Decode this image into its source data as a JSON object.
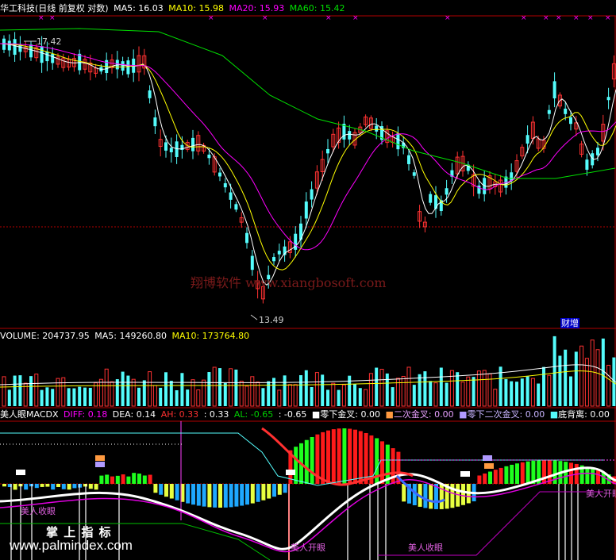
{
  "price_panel": {
    "stock_name": "华工科技(日线 前复权 对数)",
    "ma5": "MA5: 16.03",
    "ma10": "MA10: 15.98",
    "ma20": "MA20: 15.93",
    "ma60": "MA60: 15.42",
    "high_label": "17.42",
    "low_label": "13.49",
    "badge": "财增",
    "watermark": "翔博软件 www.xiangbosoft.com"
  },
  "volume_panel": {
    "volume": "VOLUME: 204737.95",
    "ma5": "MA5: 149260.80",
    "ma10": "MA10: 173764.80"
  },
  "indicator_panel": {
    "name": "美人眼MACDX",
    "diff": "DIFF: 0.18",
    "dea": "DEA: 0.14",
    "ah": "AH: 0.33",
    "ah2": ": 0.33",
    "al": "AL: -0.65",
    "al2": ": -0.65",
    "l1": "零下金叉: 0.00",
    "l2": "二次金叉: 0.00",
    "l3": "零下二次金叉: 0.00",
    "l4": "底背离: 0.00",
    "eye_open_1": "美人开眼",
    "eye_open_2": "美人开眼",
    "eye_close_1": "美人收眼",
    "eye_close_2": "美人收眼"
  },
  "watermark2": {
    "cn": "掌 上 指 标",
    "url": "www.palmindex.com"
  },
  "colors": {
    "grid": "#b00000",
    "up": "#ff3232",
    "down": "#54fcfc",
    "ma5": "#ffffff",
    "ma10": "#ffff00",
    "ma20": "#ff00ff",
    "ma60": "#00e000"
  }
}
